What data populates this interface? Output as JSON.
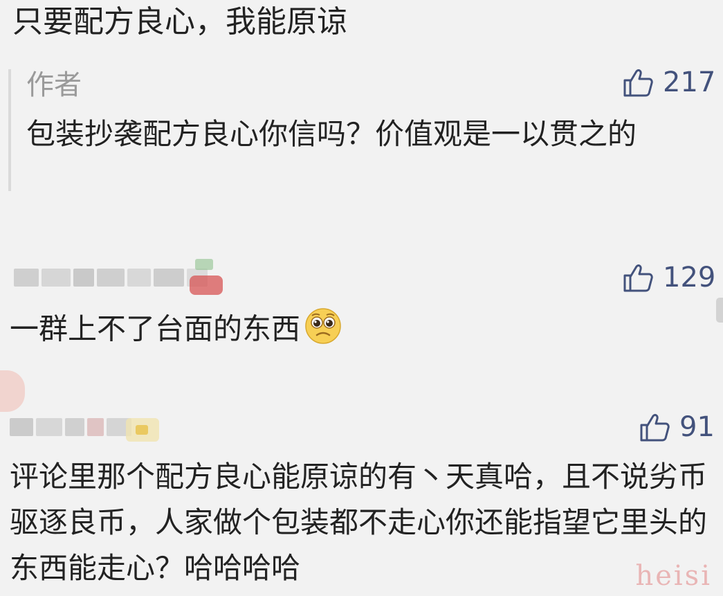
{
  "top_comment_tail": "只要配方良心，我能原谅",
  "reply": {
    "author": "作者",
    "text": "包装抄袭配方良心你信吗？价值观是一以贯之的",
    "likes": "217"
  },
  "comments": [
    {
      "text": "一群上不了台面的东西",
      "likes": "129",
      "emoji": "pleading-face"
    },
    {
      "text": "评论里那个配方良心能原谅的有丶天真哈，且不说劣币驱逐良币，人家做个包装都不走心你还能指望它里头的东西能走心？哈哈哈哈",
      "likes": "91"
    }
  ],
  "watermark": "heisi",
  "colors": {
    "like_blue": "#43527c",
    "text": "#222222",
    "muted": "#9a9a9a",
    "background": "#f2f2f2"
  },
  "icons": {
    "like": "thumbs-up-icon"
  }
}
